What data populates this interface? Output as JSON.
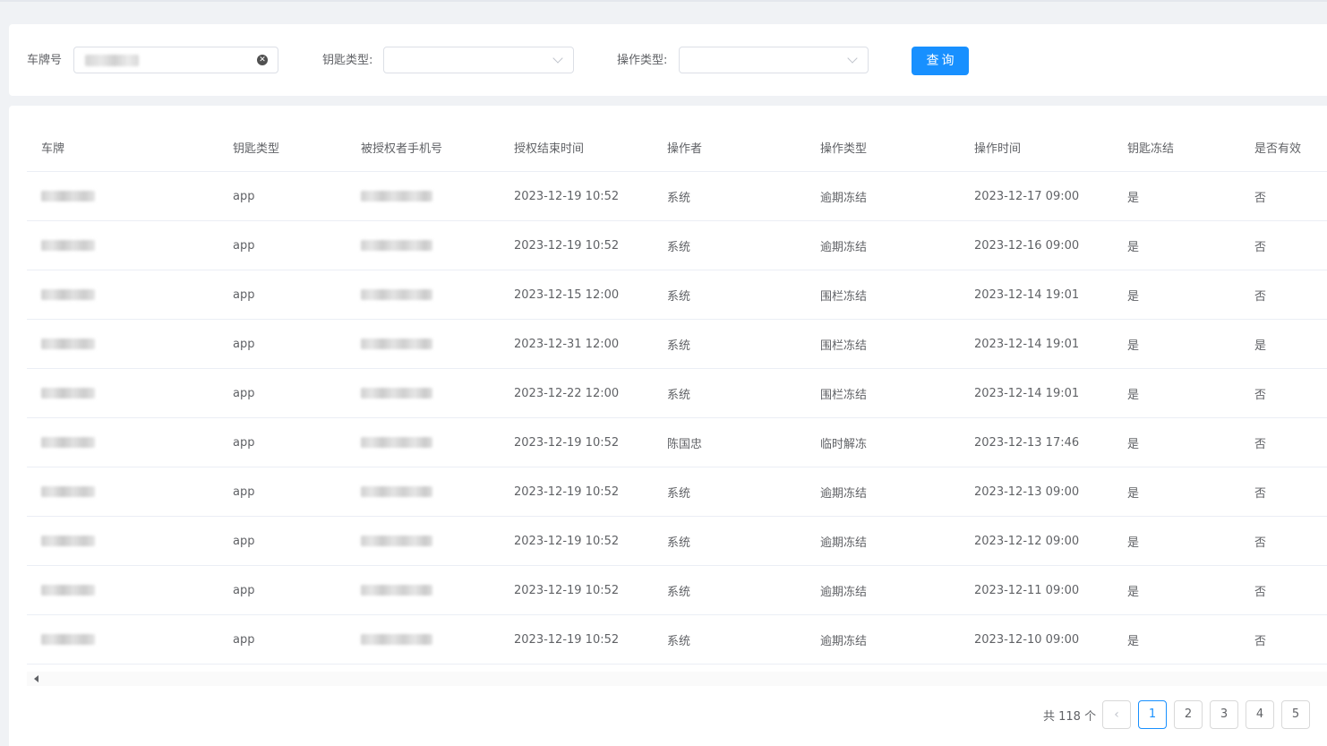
{
  "filters": {
    "plate_label": "车牌号",
    "key_type_label": "钥匙类型:",
    "op_type_label": "操作类型:",
    "query_label": "查询"
  },
  "table": {
    "columns": [
      "车牌",
      "钥匙类型",
      "被授权者手机号",
      "授权结束时间",
      "操作者",
      "操作类型",
      "操作时间",
      "钥匙冻结",
      "是否有效"
    ],
    "rows": [
      {
        "key_type": "app",
        "end_time": "2023-12-19 10:52",
        "operator": "系统",
        "op_type": "逾期冻结",
        "op_time": "2023-12-17 09:00",
        "frozen": "是",
        "valid": "否"
      },
      {
        "key_type": "app",
        "end_time": "2023-12-19 10:52",
        "operator": "系统",
        "op_type": "逾期冻结",
        "op_time": "2023-12-16 09:00",
        "frozen": "是",
        "valid": "否"
      },
      {
        "key_type": "app",
        "end_time": "2023-12-15 12:00",
        "operator": "系统",
        "op_type": "围栏冻结",
        "op_time": "2023-12-14 19:01",
        "frozen": "是",
        "valid": "否"
      },
      {
        "key_type": "app",
        "end_time": "2023-12-31 12:00",
        "operator": "系统",
        "op_type": "围栏冻结",
        "op_time": "2023-12-14 19:01",
        "frozen": "是",
        "valid": "是"
      },
      {
        "key_type": "app",
        "end_time": "2023-12-22 12:00",
        "operator": "系统",
        "op_type": "围栏冻结",
        "op_time": "2023-12-14 19:01",
        "frozen": "是",
        "valid": "否"
      },
      {
        "key_type": "app",
        "end_time": "2023-12-19 10:52",
        "operator": "陈国忠",
        "op_type": "临时解冻",
        "op_time": "2023-12-13 17:46",
        "frozen": "是",
        "valid": "否"
      },
      {
        "key_type": "app",
        "end_time": "2023-12-19 10:52",
        "operator": "系统",
        "op_type": "逾期冻结",
        "op_time": "2023-12-13 09:00",
        "frozen": "是",
        "valid": "否"
      },
      {
        "key_type": "app",
        "end_time": "2023-12-19 10:52",
        "operator": "系统",
        "op_type": "逾期冻结",
        "op_time": "2023-12-12 09:00",
        "frozen": "是",
        "valid": "否"
      },
      {
        "key_type": "app",
        "end_time": "2023-12-19 10:52",
        "operator": "系统",
        "op_type": "逾期冻结",
        "op_time": "2023-12-11 09:00",
        "frozen": "是",
        "valid": "否"
      },
      {
        "key_type": "app",
        "end_time": "2023-12-19 10:52",
        "operator": "系统",
        "op_type": "逾期冻结",
        "op_time": "2023-12-10 09:00",
        "frozen": "是",
        "valid": "否"
      }
    ]
  },
  "pagination": {
    "total_text": "共 118 个",
    "pages": [
      "1",
      "2",
      "3",
      "4",
      "5"
    ],
    "current": "1"
  },
  "icons": {
    "clear": "close-circle-icon",
    "dropdown": "chevron-down-icon",
    "prev": "chevron-left-icon",
    "scroll_left": "caret-left-icon"
  },
  "colors": {
    "primary": "#1890ff",
    "background": "#f0f2f5",
    "text": "#606266",
    "border": "#dcdfe6"
  }
}
